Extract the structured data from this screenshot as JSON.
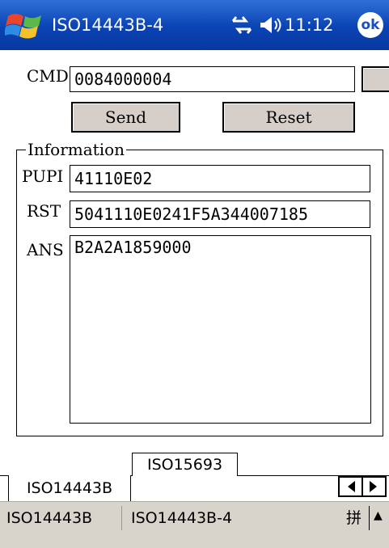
{
  "status_bar": {
    "app_title": "ISO14443B-4",
    "time": "11:12",
    "ok_label": "ok"
  },
  "cmd": {
    "label": "CMD",
    "value": "0084000004"
  },
  "buttons": {
    "send": "Send",
    "reset": "Reset"
  },
  "information": {
    "legend": "Information",
    "pupi_label": "PUPI",
    "pupi_value": "41110E02",
    "rst_label": "RST",
    "rst_value": "5041110E0241F5A344007185",
    "ans_label": "ANS",
    "ans_value": "B2A2A1859000"
  },
  "tabs": [
    {
      "label": "ISO14443B",
      "active": true
    },
    {
      "label": "ISO15693",
      "active": false
    }
  ],
  "bottom_bar": {
    "left": "ISO14443B",
    "right": "ISO14443B-4",
    "ime": "拼",
    "ime_arrow": "▲"
  }
}
